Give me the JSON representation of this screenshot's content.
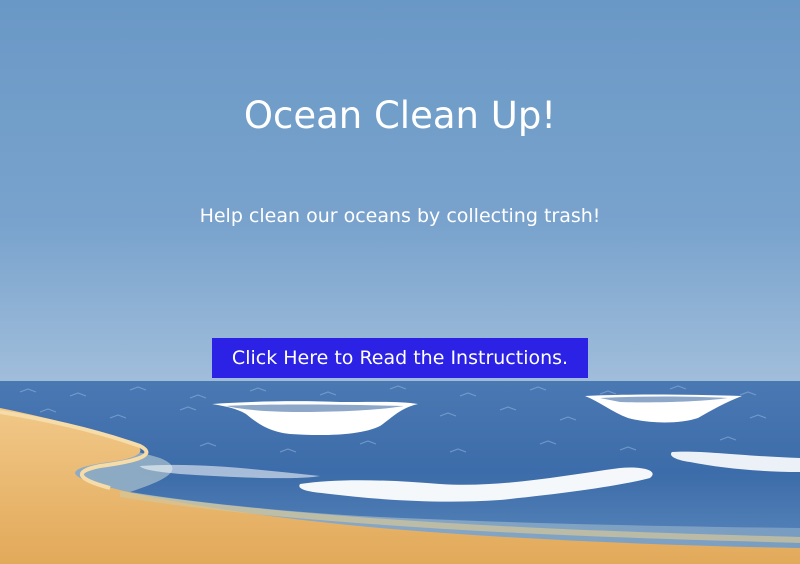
{
  "title": "Ocean Clean Up!",
  "subtitle": "Help clean our oceans by collecting trash!",
  "instructions_button": {
    "label": "Click Here to Read the Instructions.",
    "color": "#2b22e6"
  },
  "colors": {
    "sky_top": "#6a98c6",
    "sky_bottom": "#c6d7ea",
    "ocean": "#3f6fae",
    "sand": "#e8b66c",
    "foam": "#ffffff"
  }
}
